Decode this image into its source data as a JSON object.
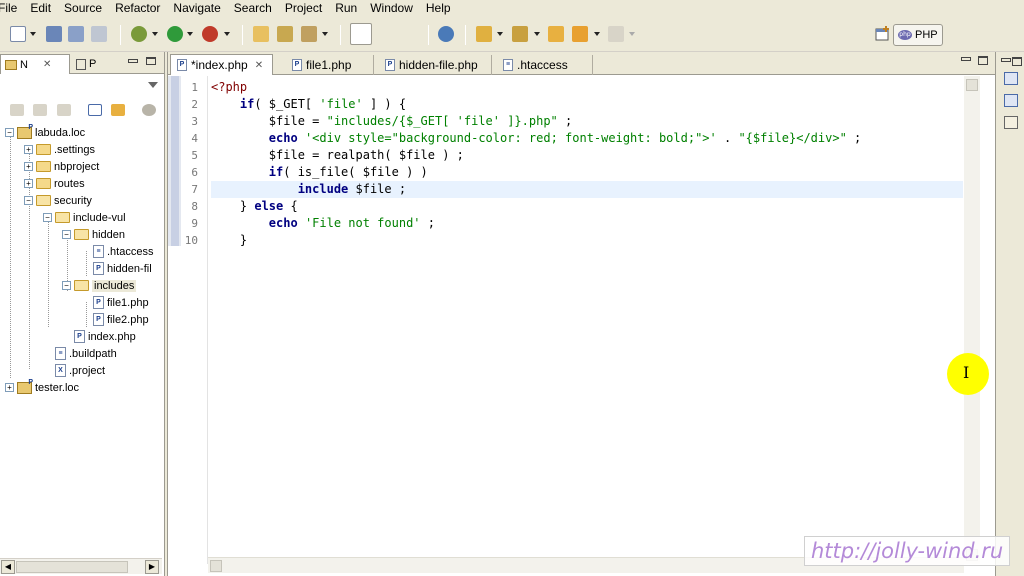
{
  "menubar": {
    "items": [
      "File",
      "Edit",
      "Source",
      "Refactor",
      "Navigate",
      "Search",
      "Project",
      "Run",
      "Window",
      "Help"
    ]
  },
  "toolbar": {
    "perspective_label": "PHP"
  },
  "navigator": {
    "tab_active_label": "N",
    "tab_inactive_label": "P",
    "tree": [
      {
        "label": "labuda.loc",
        "kind": "project",
        "depth": 0,
        "expander": "−"
      },
      {
        "label": ".settings",
        "kind": "folder",
        "depth": 1,
        "expander": "+"
      },
      {
        "label": "nbproject",
        "kind": "folder",
        "depth": 1,
        "expander": "+"
      },
      {
        "label": "routes",
        "kind": "folder",
        "depth": 1,
        "expander": "+"
      },
      {
        "label": "security",
        "kind": "folder-open",
        "depth": 1,
        "expander": "−"
      },
      {
        "label": "include-vul",
        "kind": "folder-open",
        "depth": 2,
        "expander": "−"
      },
      {
        "label": "hidden",
        "kind": "folder-open",
        "depth": 3,
        "expander": "−"
      },
      {
        "label": ".htaccess",
        "kind": "file",
        "depth": 4,
        "expander": ""
      },
      {
        "label": "hidden-fil",
        "kind": "php",
        "depth": 4,
        "expander": ""
      },
      {
        "label": "includes",
        "kind": "folder-open",
        "depth": 3,
        "expander": "−",
        "selected": true
      },
      {
        "label": "file1.php",
        "kind": "php",
        "depth": 4,
        "expander": ""
      },
      {
        "label": "file2.php",
        "kind": "php",
        "depth": 4,
        "expander": ""
      },
      {
        "label": "index.php",
        "kind": "php",
        "depth": 3,
        "expander": ""
      },
      {
        "label": ".buildpath",
        "kind": "file",
        "depth": 2,
        "expander": ""
      },
      {
        "label": ".project",
        "kind": "xfile",
        "depth": 2,
        "expander": ""
      },
      {
        "label": "tester.loc",
        "kind": "project",
        "depth": 0,
        "expander": "+"
      }
    ]
  },
  "editor": {
    "tabs": [
      {
        "label": "*index.php",
        "active": true,
        "closable": true
      },
      {
        "label": "file1.php",
        "active": false
      },
      {
        "label": "hidden-file.php",
        "active": false
      },
      {
        "label": ".htaccess",
        "active": false
      }
    ],
    "line_numbers": [
      "1",
      "2",
      "3",
      "4",
      "5",
      "6",
      "7",
      "8",
      "9",
      "10"
    ],
    "current_line": 7,
    "lines": [
      [
        {
          "t": "<?php",
          "c": "tag"
        }
      ],
      [
        {
          "t": "    ",
          "c": "txt"
        },
        {
          "t": "if",
          "c": "kw"
        },
        {
          "t": "( $_GET[ ",
          "c": "var"
        },
        {
          "t": "'file'",
          "c": "str"
        },
        {
          "t": " ] ) {",
          "c": "txt"
        }
      ],
      [
        {
          "t": "        $file = ",
          "c": "var"
        },
        {
          "t": "\"includes/{$_GET[ 'file' ]}.php\"",
          "c": "str"
        },
        {
          "t": " ;",
          "c": "txt"
        }
      ],
      [
        {
          "t": "        ",
          "c": "txt"
        },
        {
          "t": "echo",
          "c": "kw"
        },
        {
          "t": " ",
          "c": "txt"
        },
        {
          "t": "'<div style=\"background-color: red; font-weight: bold;\">'",
          "c": "str"
        },
        {
          "t": " . ",
          "c": "txt"
        },
        {
          "t": "\"{$file}</div>\"",
          "c": "str"
        },
        {
          "t": " ;",
          "c": "txt"
        }
      ],
      [
        {
          "t": "        $file = realpath( $file ) ;",
          "c": "var"
        }
      ],
      [
        {
          "t": "        ",
          "c": "txt"
        },
        {
          "t": "if",
          "c": "kw"
        },
        {
          "t": "( is_file( $file ) )",
          "c": "var"
        }
      ],
      [
        {
          "t": "            ",
          "c": "txt"
        },
        {
          "t": "include",
          "c": "kw"
        },
        {
          "t": " $file ;",
          "c": "var"
        }
      ],
      [
        {
          "t": "    } ",
          "c": "txt"
        },
        {
          "t": "else",
          "c": "kw"
        },
        {
          "t": " {",
          "c": "txt"
        }
      ],
      [
        {
          "t": "        ",
          "c": "txt"
        },
        {
          "t": "echo",
          "c": "kw"
        },
        {
          "t": " ",
          "c": "txt"
        },
        {
          "t": "'File not found'",
          "c": "str"
        },
        {
          "t": " ;",
          "c": "txt"
        }
      ],
      [
        {
          "t": "    }",
          "c": "txt"
        }
      ]
    ]
  },
  "watermark": {
    "text": "http://jolly-wind.ru"
  },
  "colors": {
    "keyword": "#000080",
    "string": "#008000",
    "tag": "#800000",
    "current_line": "#e8f2fe",
    "cursor_highlight": "#ffff00",
    "watermark": "#b48ad8"
  }
}
